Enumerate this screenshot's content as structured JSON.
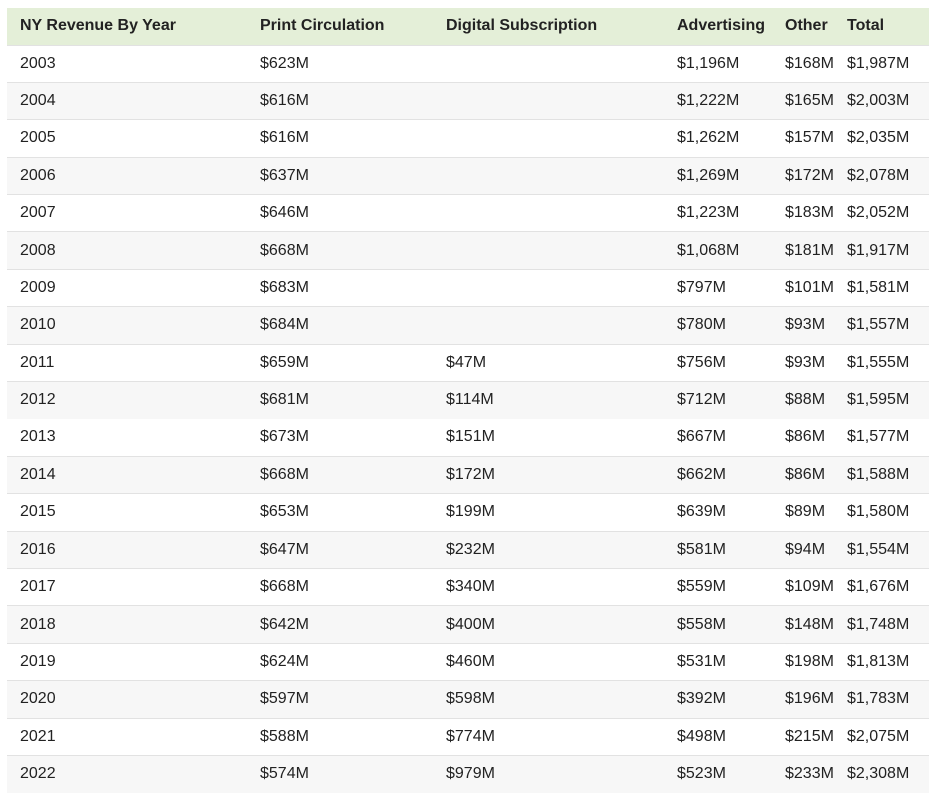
{
  "chart_data": {
    "type": "table",
    "headers": [
      "NY Revenue By Year",
      "Print Circulation",
      "Digital Subscription",
      "Advertising",
      "Other",
      "Total"
    ],
    "rows": [
      [
        "2003",
        "$623M",
        "",
        "$1,196M",
        "$168M",
        "$1,987M"
      ],
      [
        "2004",
        "$616M",
        "",
        "$1,222M",
        "$165M",
        "$2,003M"
      ],
      [
        "2005",
        "$616M",
        "",
        "$1,262M",
        "$157M",
        "$2,035M"
      ],
      [
        "2006",
        "$637M",
        "",
        "$1,269M",
        "$172M",
        "$2,078M"
      ],
      [
        "2007",
        "$646M",
        "",
        "$1,223M",
        "$183M",
        "$2,052M"
      ],
      [
        "2008",
        "$668M",
        "",
        "$1,068M",
        "$181M",
        "$1,917M"
      ],
      [
        "2009",
        "$683M",
        "",
        "$797M",
        "$101M",
        "$1,581M"
      ],
      [
        "2010",
        "$684M",
        "",
        "$780M",
        "$93M",
        "$1,557M"
      ],
      [
        "2011",
        "$659M",
        "$47M",
        "$756M",
        "$93M",
        "$1,555M"
      ],
      [
        "2012",
        "$681M",
        "$114M",
        "$712M",
        "$88M",
        "$1,595M"
      ],
      [
        "2013",
        "$673M",
        "$151M",
        "$667M",
        "$86M",
        "$1,577M"
      ],
      [
        "2014",
        "$668M",
        "$172M",
        "$662M",
        "$86M",
        "$1,588M"
      ],
      [
        "2015",
        "$653M",
        "$199M",
        "$639M",
        "$89M",
        "$1,580M"
      ],
      [
        "2016",
        "$647M",
        "$232M",
        "$581M",
        "$94M",
        "$1,554M"
      ],
      [
        "2017",
        "$668M",
        "$340M",
        "$559M",
        "$109M",
        "$1,676M"
      ],
      [
        "2018",
        "$642M",
        "$400M",
        "$558M",
        "$148M",
        "$1,748M"
      ],
      [
        "2019",
        "$624M",
        "$460M",
        "$531M",
        "$198M",
        "$1,813M"
      ],
      [
        "2020",
        "$597M",
        "$598M",
        "$392M",
        "$196M",
        "$1,783M"
      ],
      [
        "2021",
        "$588M",
        "$774M",
        "$498M",
        "$215M",
        "$2,075M"
      ],
      [
        "2022",
        "$574M",
        "$979M",
        "$523M",
        "$233M",
        "$2,308M"
      ]
    ]
  },
  "colors": {
    "header_background": "#e4efd8",
    "stripe_background": "#f7f7f7",
    "row_border": "#e2e2e2"
  }
}
